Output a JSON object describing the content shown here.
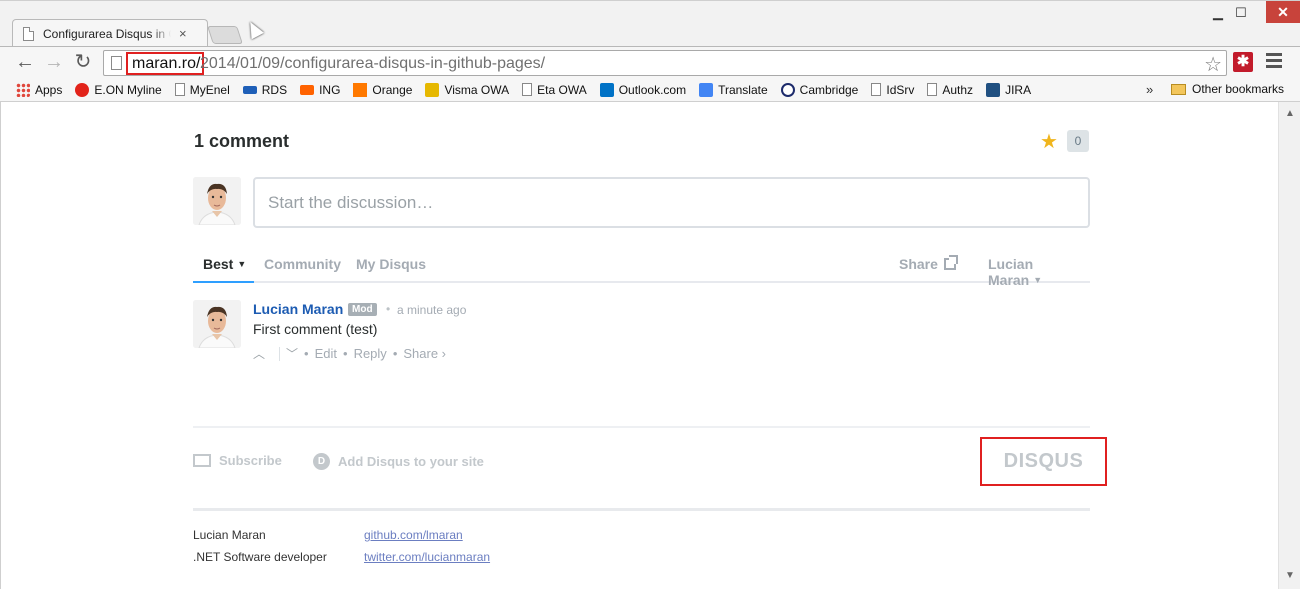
{
  "browser": {
    "tab_title": "Configurarea Disqus in GitHub Pages",
    "tab_close": "×",
    "window_controls": {
      "minimize": "▁",
      "maximize": "☐",
      "close": "✕"
    },
    "nav": {
      "back": "←",
      "forward": "→",
      "reload": "↻"
    },
    "url_host": "maran.ro/",
    "url_path": "2014/01/09/configurarea-disqus-in-github-pages/",
    "star_icon": "☆",
    "extension_icon": "✱",
    "bookmarks": [
      {
        "label": "Apps",
        "icon": "apps-grid-icon",
        "color": "#e0463b"
      },
      {
        "label": "E.ON Myline",
        "icon": "eon-icon",
        "color": "#e2231a"
      },
      {
        "label": "MyEnel",
        "icon": "page-icon",
        "color": ""
      },
      {
        "label": "RDS",
        "icon": "rds-icon",
        "color": "#1f5fb8"
      },
      {
        "label": "ING",
        "icon": "ing-lion-icon",
        "color": "#ff6200"
      },
      {
        "label": "Orange",
        "icon": "orange-icon",
        "color": "#ff7900"
      },
      {
        "label": "Visma OWA",
        "icon": "visma-icon",
        "color": "#e6b800"
      },
      {
        "label": "Eta OWA",
        "icon": "page-icon",
        "color": ""
      },
      {
        "label": "Outlook.com",
        "icon": "outlook-icon",
        "color": "#0072c6"
      },
      {
        "label": "Translate",
        "icon": "translate-icon",
        "color": "#4285f4"
      },
      {
        "label": "Cambridge",
        "icon": "cambridge-icon",
        "color": "#1d2b6b"
      },
      {
        "label": "IdSrv",
        "icon": "page-icon",
        "color": ""
      },
      {
        "label": "Authz",
        "icon": "page-icon",
        "color": ""
      },
      {
        "label": "JIRA",
        "icon": "jira-icon",
        "color": "#205081"
      }
    ],
    "bookmarks_more": "»",
    "other_bookmarks": "Other bookmarks"
  },
  "disqus": {
    "comment_count": "1 comment",
    "favorite_count": "0",
    "textbox_placeholder": "Start the discussion…",
    "tabs": {
      "best": "Best",
      "community": "Community",
      "my_disqus": "My Disqus"
    },
    "share": "Share",
    "user_menu": "Lucian Maran",
    "comments": [
      {
        "author": "Lucian Maran",
        "badge": "Mod",
        "time": "a minute ago",
        "body": "First comment (test)",
        "actions": {
          "edit": "Edit",
          "reply": "Reply",
          "share": "Share ›"
        }
      }
    ],
    "footer": {
      "subscribe": "Subscribe",
      "add_disqus": "Add Disqus to your site",
      "logo": "DISQUS"
    }
  },
  "site_footer": {
    "name": "Lucian Maran",
    "role": ".NET Software developer",
    "github": "github.com/lmaran",
    "twitter": "twitter.com/lucianmaran"
  }
}
